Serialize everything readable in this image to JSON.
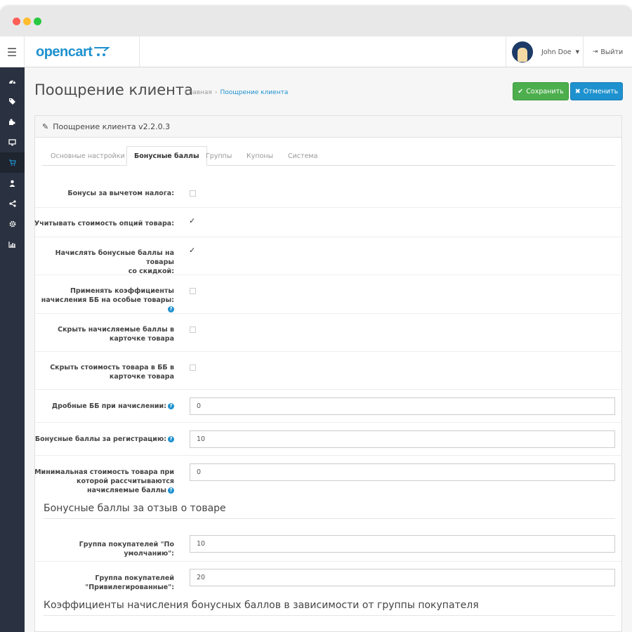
{
  "header": {
    "logo_text": "opencart",
    "user_name": "John Doe",
    "logout_label": "Выйти"
  },
  "sidebar": {
    "items": [
      {
        "icon": "dashboard-icon",
        "active": false
      },
      {
        "icon": "tags-icon",
        "active": false
      },
      {
        "icon": "puzzle-icon",
        "active": false
      },
      {
        "icon": "desktop-icon",
        "active": false
      },
      {
        "icon": "shopping-cart-icon",
        "active": true
      },
      {
        "icon": "user-icon",
        "active": false
      },
      {
        "icon": "share-icon",
        "active": false
      },
      {
        "icon": "cog-icon",
        "active": false
      },
      {
        "icon": "bar-chart-icon",
        "active": false
      }
    ]
  },
  "page": {
    "title": "Поощрение клиента",
    "breadcrumb": [
      "Главная",
      "Поощрение клиента"
    ],
    "save_label": "Сохранить",
    "cancel_label": "Отменить"
  },
  "panel": {
    "heading": "Поощрение клиента v2.2.0.3",
    "tabs": [
      "Основные настройки",
      "Бонусные баллы",
      "Группы",
      "Купоны",
      "Система"
    ],
    "active_tab": "Бонусные баллы"
  },
  "form": {
    "bonus_after_tax": {
      "label": "Бонусы за вычетом налога:",
      "checked": false
    },
    "include_options_price": {
      "label": "Учитывать стоимость опций товара:",
      "checked": true
    },
    "accrue_discounted_line1": "Начислять бонусные баллы на товары",
    "accrue_discounted_line2": "со скидкой:",
    "accrue_discounted_checked": true,
    "apply_coeff_line1": "Применять коэффициенты",
    "apply_coeff_line2": "начисления ББ на особые товары:",
    "apply_coeff_checked": false,
    "hide_accrued_line1": "Скрыть начисляемые баллы в",
    "hide_accrued_line2": "карточке товара",
    "hide_accrued_checked": false,
    "hide_price_line1": "Скрыть стоимость товара в ББ в",
    "hide_price_line2": "карточке товара",
    "hide_price_checked": false,
    "fractional": {
      "label": "Дробные ББ при начислении:",
      "value": "0"
    },
    "registration": {
      "label": "Бонусные баллы за регистрацию:",
      "value": "10"
    },
    "min_price_line1": "Минимальная стоимость товара при",
    "min_price_line2": "которой рассчитываются",
    "min_price_line3": "начисляемые баллы",
    "min_price_value": "0"
  },
  "review_section": {
    "title": "Бонусные баллы за отзыв о товаре",
    "default_group": {
      "label": "Группа покупателей \"По умолчанию\":",
      "value": "10"
    },
    "privileged_line1": "Группа покупателей",
    "privileged_line2": "\"Привилегированные\":",
    "privileged_value": "20"
  },
  "coeff_section": {
    "title": "Коэффициенты начисления бонусных баллов в зависимости от группы покупателя"
  }
}
